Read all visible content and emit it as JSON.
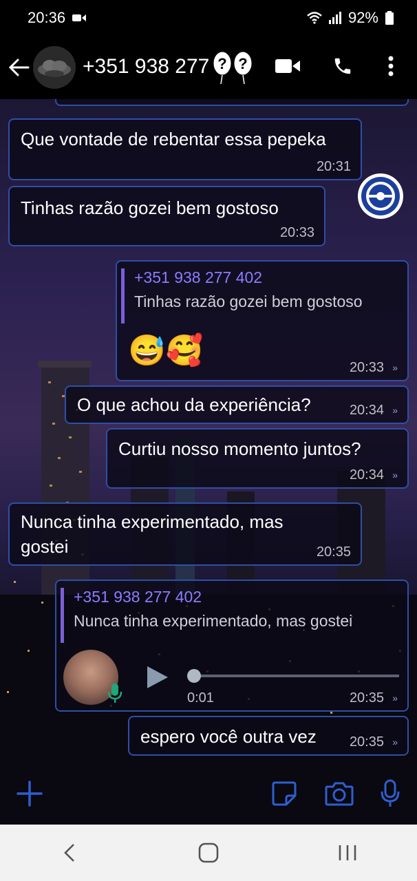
{
  "status_bar": {
    "time": "20:36",
    "battery": "92%"
  },
  "header": {
    "contact_name": "+351 938 277"
  },
  "messages": [
    {
      "text": "Que vontade de rebentar essa pepeka",
      "time": "20:31",
      "direction": "incoming"
    },
    {
      "text": "Tinhas razão gozei bem gostoso",
      "time": "20:33",
      "direction": "incoming"
    },
    {
      "quote_name": "+351 938 277 402",
      "quote_text": "Tinhas razão gozei bem gostoso",
      "text": "😅🥰",
      "time": "20:33",
      "direction": "outgoing"
    },
    {
      "text": "O que achou da experiência?",
      "time": "20:34",
      "direction": "outgoing"
    },
    {
      "text": "Curtiu nosso momento juntos?",
      "time": "20:34",
      "direction": "outgoing"
    },
    {
      "text": "Nunca tinha experimentado, mas gostei",
      "time": "20:35",
      "direction": "incoming"
    },
    {
      "quote_name": "+351 938 277 402",
      "quote_text": "Nunca tinha experimentado, mas gostei",
      "voice_duration": "0:01",
      "time": "20:35",
      "direction": "outgoing"
    },
    {
      "text": "espero você outra vez",
      "time": "20:35",
      "direction": "outgoing"
    }
  ],
  "colors": {
    "bubble_border": "#2f4fa6",
    "quote_name": "#8c7cff",
    "accent": "#2d5fd0"
  },
  "icons": [
    "back-arrow-icon",
    "video-call-icon",
    "phone-icon",
    "more-options-icon",
    "add-icon",
    "sticker-icon",
    "camera-icon",
    "microphone-icon",
    "nav-back-icon",
    "nav-home-icon",
    "nav-recents-icon"
  ]
}
